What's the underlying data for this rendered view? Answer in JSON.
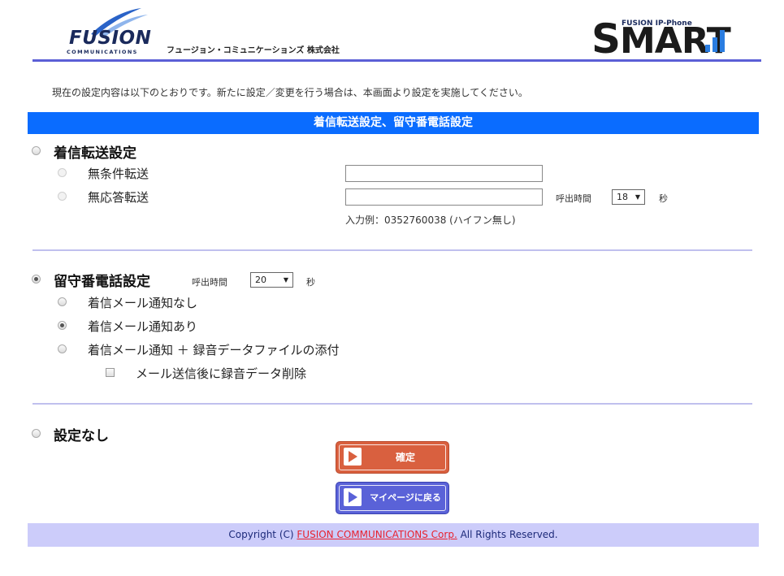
{
  "header": {
    "brand": "FUSION",
    "brand_sub": "COMMUNICATIONS",
    "company_name": "フュージョン・コミュニケーションズ 株式会社",
    "product_small": "FUSION IP-Phone",
    "product_big_first": "S",
    "product_big_rest": "MART"
  },
  "intro": "現在の設定内容は以下のとおりです。新たに設定／変更を行う場合は、本画面より設定を実施してください。",
  "section_title": "着信転送設定、留守番電話設定",
  "forwarding": {
    "title": "着信転送設定",
    "selected": false,
    "unconditional_label": "無条件転送",
    "unconditional_value": "",
    "no_answer_label": "無応答転送",
    "no_answer_value": "",
    "ring_time_label": "呼出時間",
    "ring_time_value": "18",
    "seconds_label": "秒",
    "example": "入力例：0352760038 (ハイフン無し)"
  },
  "voicemail": {
    "title": "留守番電話設定",
    "selected": true,
    "ring_time_label": "呼出時間",
    "ring_time_value": "20",
    "seconds_label": "秒",
    "options": [
      {
        "label": "着信メール通知なし",
        "checked": false
      },
      {
        "label": "着信メール通知あり",
        "checked": true
      },
      {
        "label": "着信メール通知 ＋ 録音データファイルの添付",
        "checked": false
      }
    ],
    "delete_after_send_label": "メール送信後に録音データ削除",
    "delete_after_send_checked": false
  },
  "none_setting": {
    "title": "設定なし",
    "selected": false
  },
  "buttons": {
    "confirm": "確定",
    "mypage": "マイページに戻る"
  },
  "footer": {
    "prefix": "Copyright (C) ",
    "link": "FUSION COMMUNICATIONS Corp.",
    "suffix": " All Rights Reserved."
  },
  "colors": {
    "section_bar": "#0a6cff",
    "header_rule": "#5b5fd6",
    "confirm_button": "#d9603f",
    "mypage_button": "#5a62d8",
    "footer_bg": "#ccccfa",
    "footer_link": "#e8222e"
  }
}
